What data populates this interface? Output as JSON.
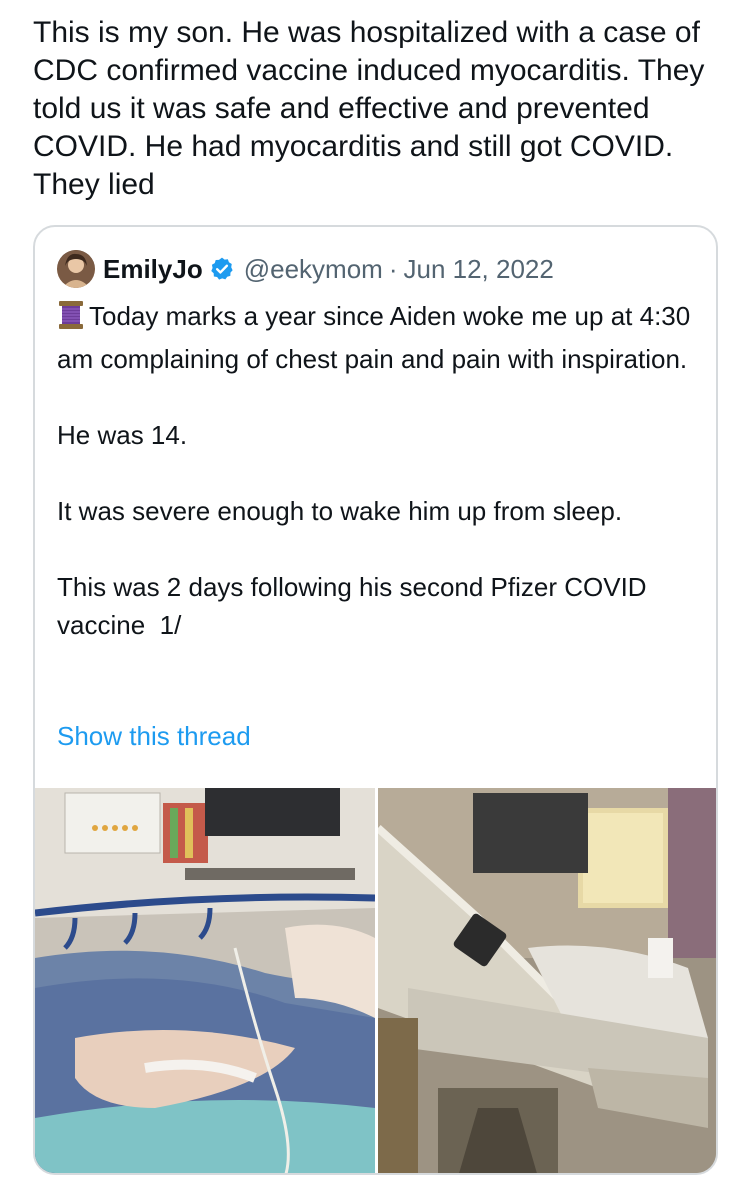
{
  "tweet": {
    "text": "This is my son. He was hospitalized with a case of CDC confirmed vaccine induced myocarditis. They told us it was safe and effective and prevented COVID. He had myocarditis and still got COVID. They lied"
  },
  "quoted_tweet": {
    "author_name": "EmilyJo",
    "handle": "@eekymom",
    "separator": "·",
    "date": "Jun 12, 2022",
    "body": [
      "Today marks a year since Aiden woke me up at 4:30 am complaining of chest pain and pain with inspiration.",
      "He was 14.",
      "It was severe enough to wake him up from sleep.",
      "This was 2 days following his second Pfizer COVID vaccine  1/"
    ],
    "show_thread_label": "Show this thread",
    "link_color": "#1d9bf0",
    "verified_color": "#1d9bf0",
    "icons": {
      "avatar": "profile-photo",
      "verified": "verified-badge-icon",
      "thread": "spool-of-thread-emoji"
    }
  }
}
